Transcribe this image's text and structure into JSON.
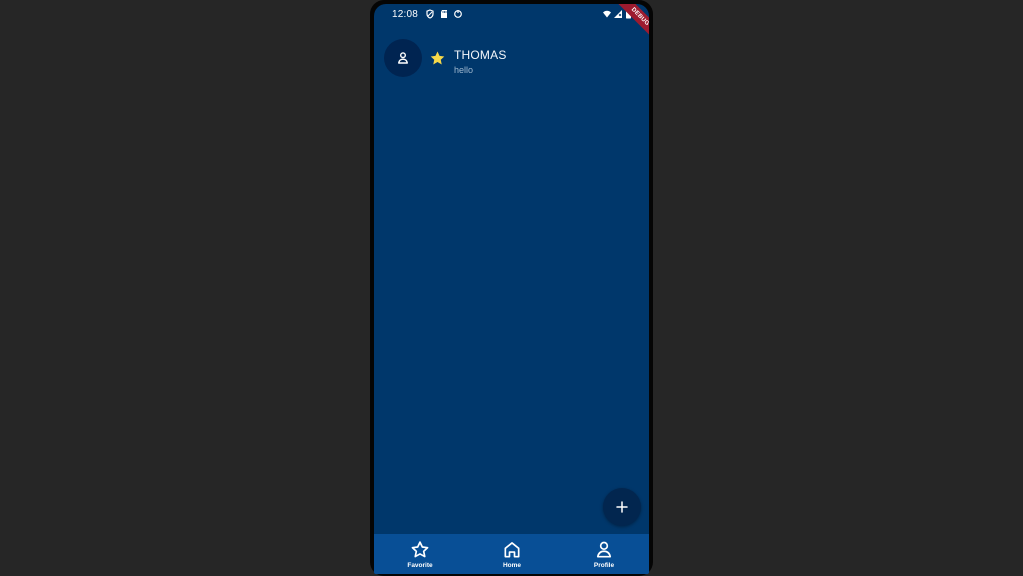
{
  "status_bar": {
    "time": "12:08",
    "debug_label": "DEBUG",
    "icons": [
      "shield-icon",
      "sd-card-icon",
      "sync-icon",
      "wifi-icon",
      "signal-icon",
      "battery-icon"
    ]
  },
  "contact": {
    "name": "THOMAS",
    "message": "hello",
    "avatar_icon": "person-icon",
    "favorite_icon": "star-filled-icon",
    "favorite": true
  },
  "fab": {
    "icon": "plus-icon"
  },
  "bottom_nav": {
    "items": [
      {
        "label": "Favorite",
        "icon": "star-outline-icon"
      },
      {
        "label": "Home",
        "icon": "home-icon"
      },
      {
        "label": "Profile",
        "icon": "person-icon"
      }
    ]
  },
  "colors": {
    "background": "#262626",
    "screen": "#00376b",
    "avatar": "#002451",
    "fab": "#02264f",
    "bottom_nav": "#084f96",
    "star": "#f6d94a",
    "debug_ribbon": "#9d1b2f"
  }
}
